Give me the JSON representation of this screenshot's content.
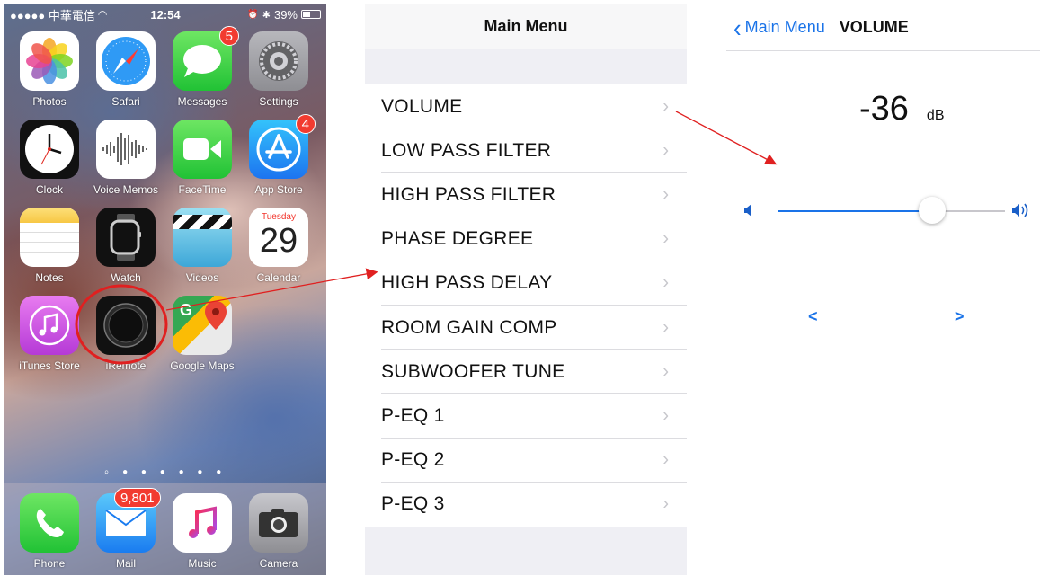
{
  "home": {
    "status": {
      "carrier": "●●●●● 中華電信",
      "time": "12:54",
      "battery": "39%",
      "battery_level": 0.39
    },
    "apps": [
      {
        "label": "Photos",
        "icon": "photos-icon",
        "badge": ""
      },
      {
        "label": "Safari",
        "icon": "safari-icon",
        "badge": ""
      },
      {
        "label": "Messages",
        "icon": "messages-icon",
        "badge": "5"
      },
      {
        "label": "Settings",
        "icon": "settings-icon",
        "badge": ""
      },
      {
        "label": "Clock",
        "icon": "clock-icon",
        "badge": ""
      },
      {
        "label": "Voice Memos",
        "icon": "voice-memos-icon",
        "badge": ""
      },
      {
        "label": "FaceTime",
        "icon": "facetime-icon",
        "badge": ""
      },
      {
        "label": "App Store",
        "icon": "app-store-icon",
        "badge": "4"
      },
      {
        "label": "Notes",
        "icon": "notes-icon",
        "badge": ""
      },
      {
        "label": "Watch",
        "icon": "watch-icon",
        "badge": ""
      },
      {
        "label": "Videos",
        "icon": "videos-icon",
        "badge": ""
      },
      {
        "label": "Calendar",
        "icon": "calendar-icon",
        "badge": "",
        "weekday": "Tuesday",
        "day": "29"
      },
      {
        "label": "iTunes Store",
        "icon": "itunes-store-icon",
        "badge": ""
      },
      {
        "label": "iRemote",
        "icon": "iremote-icon",
        "badge": ""
      },
      {
        "label": "Google Maps",
        "icon": "google-maps-icon",
        "badge": ""
      }
    ],
    "dock": [
      {
        "label": "Phone",
        "icon": "phone-icon",
        "badge": ""
      },
      {
        "label": "Mail",
        "icon": "mail-icon",
        "badge": "9,801"
      },
      {
        "label": "Music",
        "icon": "music-icon",
        "badge": ""
      },
      {
        "label": "Camera",
        "icon": "camera-icon",
        "badge": ""
      }
    ]
  },
  "menu": {
    "title": "Main Menu",
    "items": [
      "VOLUME",
      "LOW PASS FILTER",
      "HIGH PASS FILTER",
      "PHASE DEGREE",
      "HIGH PASS DELAY",
      "ROOM GAIN COMP",
      "SUBWOOFER TUNE",
      "P-EQ 1",
      "P-EQ 2",
      "P-EQ 3"
    ],
    "chevron": "›"
  },
  "volume": {
    "back_label": "Main Menu",
    "title": "VOLUME",
    "value": "-36",
    "unit": "dB",
    "slider_level": 0.68,
    "decrement": "<",
    "increment": ">"
  },
  "colors": {
    "accent": "#1a73e8",
    "badge": "#f23b30",
    "arrow": "#e02020"
  }
}
